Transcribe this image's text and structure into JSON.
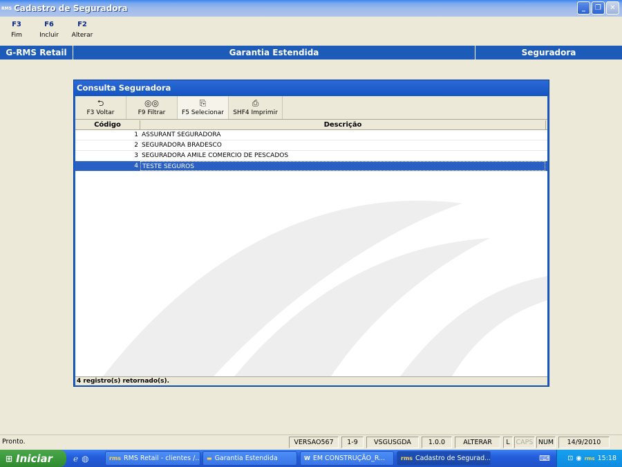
{
  "window": {
    "app_icon": "RMS",
    "title": "Cadastro de Seguradora",
    "controls": [
      "minimize-icon",
      "restore-icon",
      "close-icon"
    ]
  },
  "fkeys": [
    {
      "key": "F3",
      "label": "Fim"
    },
    {
      "key": "F6",
      "label": "Incluir"
    },
    {
      "key": "F2",
      "label": "Alterar"
    }
  ],
  "module_bar": {
    "left": "G-RMS Retail",
    "center": "Garantia Estendida",
    "right": "Seguradora"
  },
  "dialog": {
    "title": "Consulta Seguradora",
    "toolbar": [
      {
        "label": "F3 Voltar",
        "icon": "back-folder-icon"
      },
      {
        "label": "F9 Filtrar",
        "icon": "binoculars-icon"
      },
      {
        "label": "F5 Selecionar",
        "icon": "select-icon"
      },
      {
        "label": "SHF4 Imprimir",
        "icon": "printer-icon"
      }
    ],
    "columns": [
      "Código",
      "Descrição"
    ],
    "rows": [
      {
        "code": "1",
        "desc": "ASSURANT SEGURADORA"
      },
      {
        "code": "2",
        "desc": "SEGURADORA BRADESCO"
      },
      {
        "code": "3",
        "desc": "SEGURADORA AMILE COMERCIO DE PESCADOS"
      },
      {
        "code": "4",
        "desc": "TESTE SEGUROS",
        "selected": true
      }
    ],
    "footer": "4 registro(s) retornado(s)."
  },
  "statusbar": {
    "ready": "Pronto.",
    "panels": [
      "VERSAO567",
      "1-9",
      "VSGUSGDA",
      "1.0.0",
      "ALTERAR",
      "L",
      "CAPS",
      "NUM",
      "14/9/2010"
    ]
  },
  "taskbar": {
    "start": "Iniciar",
    "tasks": [
      {
        "label": "RMS Retail - clientes /...",
        "icon": "rms-icon"
      },
      {
        "label": "Garantia Estendida",
        "icon": "folder-icon"
      },
      {
        "label": "EM CONSTRUÇÃO_R...",
        "icon": "word-icon"
      },
      {
        "label": "Cadastro de Segurad...",
        "icon": "rms-icon",
        "active": true
      }
    ],
    "clock": "15:18"
  }
}
